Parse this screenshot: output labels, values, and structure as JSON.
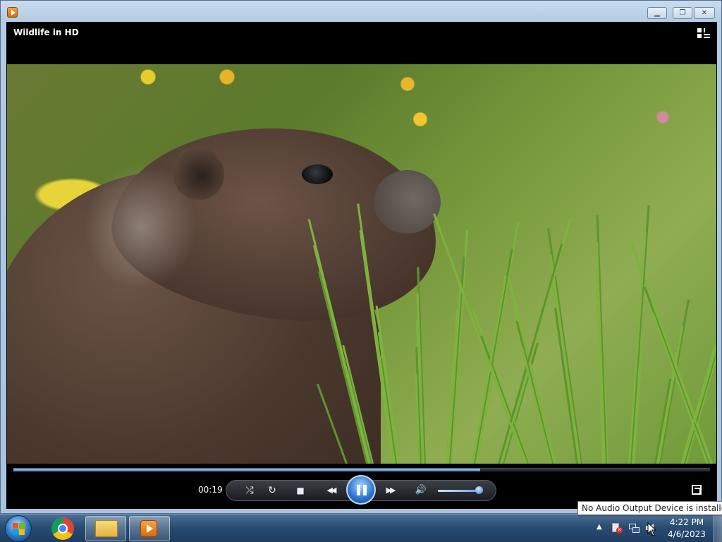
{
  "window": {
    "title": "Wildlife in HD"
  },
  "player": {
    "time_elapsed": "00:19",
    "progress": 0.67,
    "volume": 0.9,
    "state": "playing"
  },
  "icons": {
    "title_app": "windows-media-player-icon",
    "switch_to_library": "switch-to-library-icon",
    "shuffle": "shuffle-icon",
    "repeat": "repeat-icon",
    "stop": "stop-icon",
    "previous": "previous-icon",
    "pause": "pause-icon",
    "next": "next-icon",
    "mute": "speaker-icon",
    "fullscreen": "fullscreen-icon"
  },
  "glyphs": {
    "minimize": "▁",
    "maximize": "❐",
    "close": "✕",
    "shuffle": "⤮",
    "repeat": "↻",
    "stop": "■",
    "previous": "◀◀",
    "next": "▶▶",
    "speaker": "🔊",
    "tray_arrow": "▲"
  },
  "taskbar": {
    "clock_time": "4:22 PM",
    "clock_date": "4/6/2023"
  },
  "tooltip": {
    "text": "No Audio Output Device is installed."
  },
  "colors": {
    "accent": "#2f79d6",
    "seek_fill": "#4f86c9"
  }
}
